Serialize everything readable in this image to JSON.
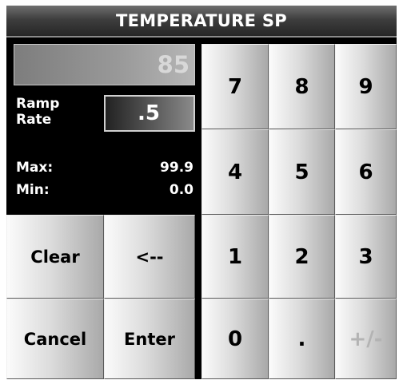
{
  "title": "TEMPERATURE SP",
  "display": {
    "value": "85"
  },
  "ramp_rate": {
    "label": "Ramp\nRate",
    "value": ".5"
  },
  "limits": {
    "max_label": "Max:",
    "max_value": "99.9",
    "min_label": "Min:",
    "min_value": "0.0"
  },
  "left_buttons": {
    "clear": "Clear",
    "backspace": "<--",
    "cancel": "Cancel",
    "enter": "Enter"
  },
  "keypad": {
    "k7": "7",
    "k8": "8",
    "k9": "9",
    "k4": "4",
    "k5": "5",
    "k6": "6",
    "k1": "1",
    "k2": "2",
    "k3": "3",
    "k0": "0",
    "dot": ".",
    "plusminus": "+/-"
  },
  "colors": {
    "background": "#000000",
    "button_light": "#fbfbfb",
    "button_dark": "#a9a9a9",
    "disabled_text": "#b3b3b3"
  }
}
